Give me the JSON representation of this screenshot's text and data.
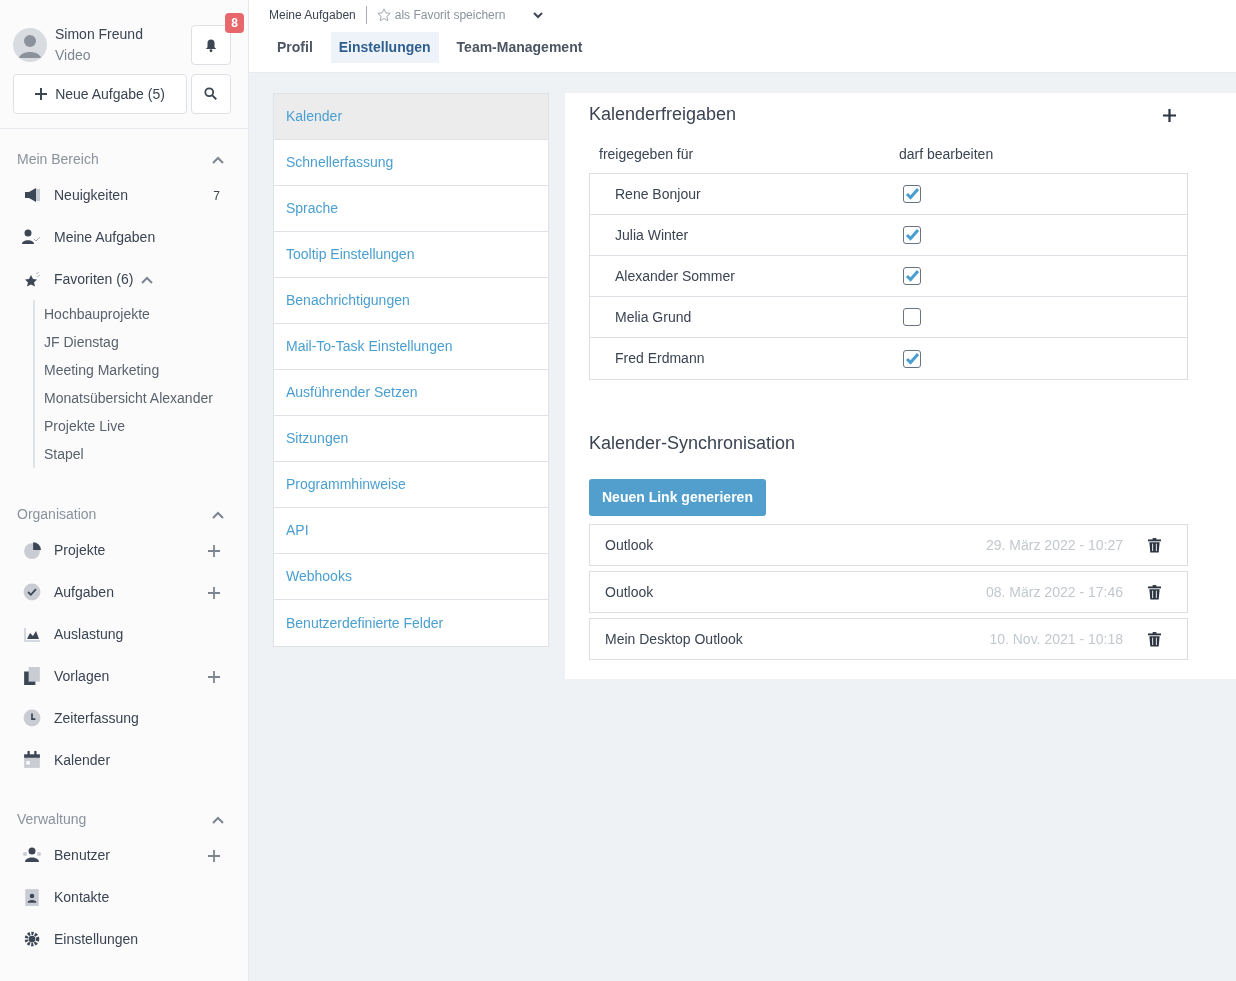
{
  "user": {
    "name": "Simon Freund",
    "subtitle": "Video",
    "notifications": "8"
  },
  "new_task_button": "Neue Aufgabe (5)",
  "sidebar": [
    {
      "title": "Mein Bereich",
      "expanded": true,
      "items": [
        {
          "label": "Neuigkeiten",
          "count": "7",
          "add_button": false
        },
        {
          "label": "Meine Aufgaben",
          "add_button": false
        },
        {
          "label": "Favoriten (6)",
          "add_button": false,
          "expanded": true,
          "children": [
            {
              "label": "Hochbauprojekte"
            },
            {
              "label": "JF Dienstag"
            },
            {
              "label": "Meeting Marketing"
            },
            {
              "label": "Monatsübersicht Alexander"
            },
            {
              "label": "Projekte Live"
            },
            {
              "label": "Stapel"
            }
          ]
        }
      ]
    },
    {
      "title": "Organisation",
      "expanded": true,
      "items": [
        {
          "label": "Projekte",
          "add_button": true
        },
        {
          "label": "Aufgaben",
          "add_button": true
        },
        {
          "label": "Auslastung",
          "add_button": false
        },
        {
          "label": "Vorlagen",
          "add_button": true
        },
        {
          "label": "Zeiterfassung",
          "add_button": false
        },
        {
          "label": "Kalender",
          "add_button": false
        }
      ]
    },
    {
      "title": "Verwaltung",
      "expanded": true,
      "items": [
        {
          "label": "Benutzer",
          "add_button": true
        },
        {
          "label": "Kontakte",
          "add_button": false
        },
        {
          "label": "Einstellungen",
          "add_button": false
        }
      ]
    }
  ],
  "breadcrumb": {
    "page": "Meine Aufgaben",
    "favorite": "als Favorit speichern"
  },
  "tabs": [
    {
      "label": "Profil",
      "selected": false
    },
    {
      "label": "Einstellungen",
      "selected": true
    },
    {
      "label": "Team-Management",
      "selected": false
    }
  ],
  "settings_menu": [
    {
      "label": "Kalender",
      "selected": true
    },
    {
      "label": "Schnellerfassung",
      "selected": false
    },
    {
      "label": "Sprache",
      "selected": false
    },
    {
      "label": "Tooltip Einstellungen",
      "selected": false
    },
    {
      "label": "Benachrichtigungen",
      "selected": false
    },
    {
      "label": "Mail-To-Task Einstellungen",
      "selected": false
    },
    {
      "label": "Ausführender Setzen",
      "selected": false
    },
    {
      "label": "Sitzungen",
      "selected": false
    },
    {
      "label": "Programmhinweise",
      "selected": false
    },
    {
      "label": "API",
      "selected": false
    },
    {
      "label": "Webhooks",
      "selected": false
    },
    {
      "label": "Benutzerdefinierte Felder",
      "selected": false
    }
  ],
  "shares": {
    "title": "Kalenderfreigaben",
    "columns": [
      "freigegeben für",
      "darf bearbeiten"
    ],
    "rows": [
      {
        "name": "Rene Bonjour",
        "checked": true
      },
      {
        "name": "Julia Winter",
        "checked": true
      },
      {
        "name": "Alexander Sommer",
        "checked": true
      },
      {
        "name": "Melia Grund",
        "checked": false
      },
      {
        "name": "Fred Erdmann",
        "checked": true
      }
    ]
  },
  "sync": {
    "title": "Kalender-Synchronisation",
    "button": "Neuen Link generieren",
    "links": [
      {
        "name": "Outlook",
        "date": "29. März 2022 - 10:27"
      },
      {
        "name": "Outlook",
        "date": "08. März 2022 - 17:46"
      },
      {
        "name": "Mein Desktop Outlook",
        "date": "10. Nov. 2021 - 10:18"
      }
    ]
  }
}
